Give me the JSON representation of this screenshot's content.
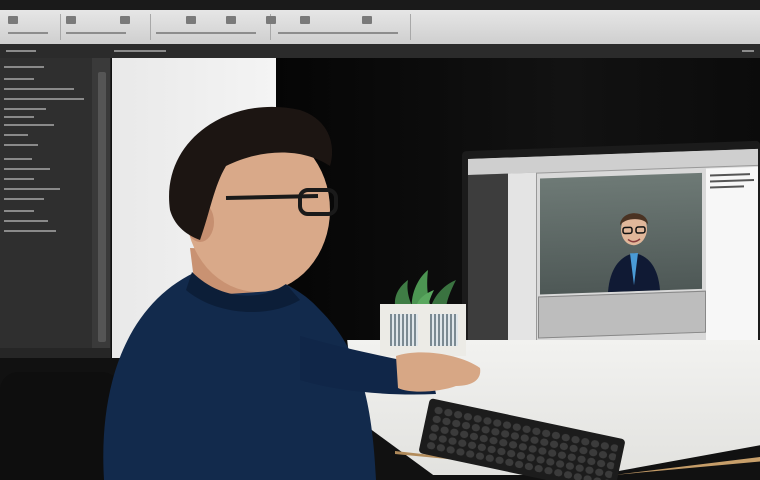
{
  "scene": {
    "description_labels": {
      "editor_window": "video-editing-software-window",
      "subject": "person-at-computer"
    },
    "colors": {
      "jacket": "#122a4c",
      "desk": "#efefec",
      "monitor_frame": "#1b1b1b",
      "background_dark": "#0a0a0a"
    }
  }
}
